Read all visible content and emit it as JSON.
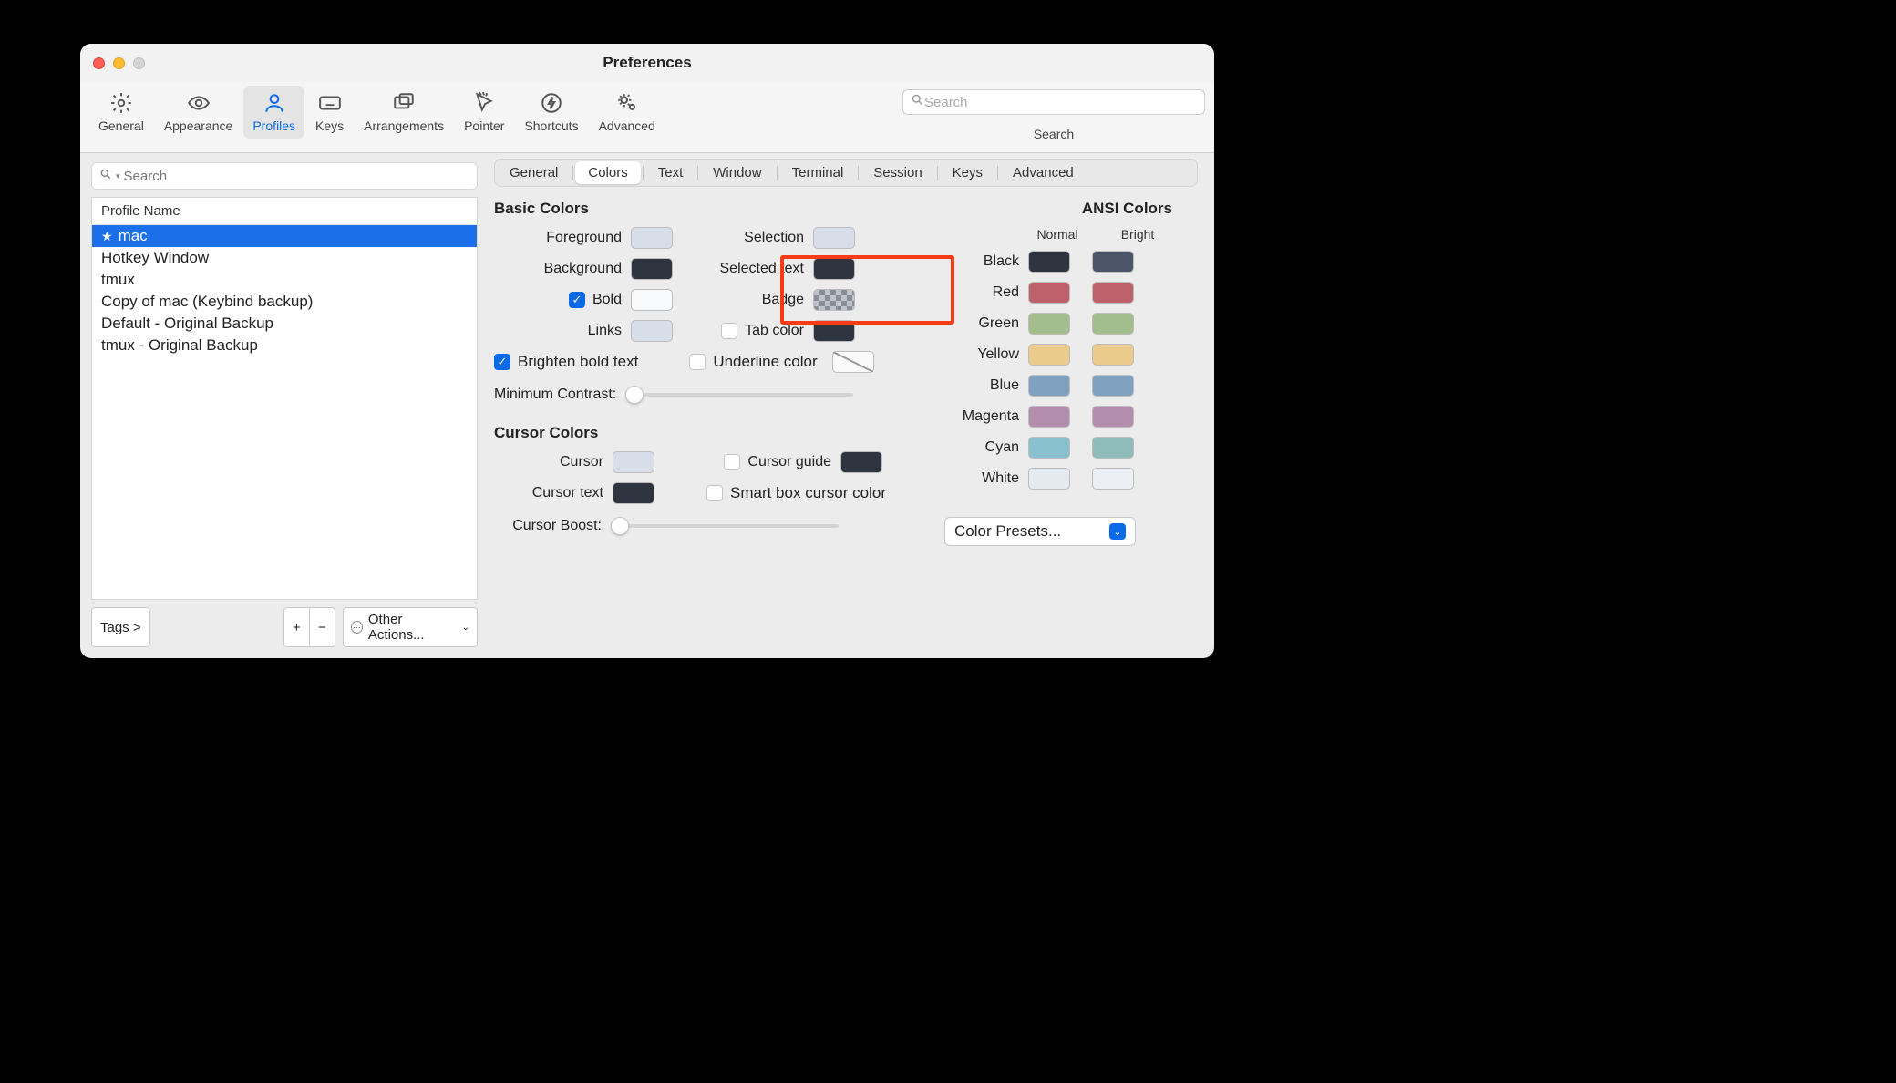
{
  "window": {
    "title": "Preferences"
  },
  "toolbar": {
    "items": [
      {
        "label": "General"
      },
      {
        "label": "Appearance"
      },
      {
        "label": "Profiles"
      },
      {
        "label": "Keys"
      },
      {
        "label": "Arrangements"
      },
      {
        "label": "Pointer"
      },
      {
        "label": "Shortcuts"
      },
      {
        "label": "Advanced"
      }
    ],
    "search_placeholder": "Search",
    "search_label": "Search"
  },
  "sidebar": {
    "search_placeholder": "Search",
    "header": "Profile Name",
    "profiles": [
      {
        "name": "mac",
        "starred": true,
        "selected": true
      },
      {
        "name": "Hotkey Window"
      },
      {
        "name": "tmux"
      },
      {
        "name": "Copy of mac (Keybind backup)"
      },
      {
        "name": "Default - Original Backup"
      },
      {
        "name": "tmux - Original Backup"
      }
    ],
    "tags_label": "Tags >",
    "other_actions_label": "Other Actions..."
  },
  "subtabs": [
    "General",
    "Colors",
    "Text",
    "Window",
    "Terminal",
    "Session",
    "Keys",
    "Advanced"
  ],
  "subtab_active": "Colors",
  "basic": {
    "title": "Basic Colors",
    "foreground": {
      "label": "Foreground",
      "color": "#d7dde9"
    },
    "background": {
      "label": "Background",
      "color": "#2e3440"
    },
    "bold": {
      "label": "Bold",
      "color": "#f7f9fb",
      "checked": true
    },
    "links": {
      "label": "Links",
      "color": "#d7dde9"
    },
    "selection": {
      "label": "Selection",
      "color": "#d7dde9"
    },
    "selected_text": {
      "label": "Selected text",
      "color": "#2e3440"
    },
    "badge": {
      "label": "Badge"
    },
    "tab_color": {
      "label": "Tab color",
      "color": "#2e3440",
      "checked": false
    },
    "brighten_bold": {
      "label": "Brighten bold text",
      "checked": true
    },
    "underline_color": {
      "label": "Underline color",
      "checked": false
    },
    "min_contrast_label": "Minimum Contrast:"
  },
  "cursor": {
    "title": "Cursor Colors",
    "cursor": {
      "label": "Cursor",
      "color": "#d7dde9"
    },
    "cursor_text": {
      "label": "Cursor text",
      "color": "#2e3440"
    },
    "cursor_guide": {
      "label": "Cursor guide",
      "color": "#2e3440",
      "checked": false
    },
    "smart_box": {
      "label": "Smart box cursor color",
      "checked": false
    },
    "boost_label": "Cursor Boost:"
  },
  "ansi": {
    "title": "ANSI Colors",
    "cols": {
      "normal": "Normal",
      "bright": "Bright"
    },
    "rows": [
      {
        "name": "Black",
        "normal": "#2e3440",
        "bright": "#4c566a"
      },
      {
        "name": "Red",
        "normal": "#bf616a",
        "bright": "#bf616a"
      },
      {
        "name": "Green",
        "normal": "#a3be8c",
        "bright": "#a3be8c"
      },
      {
        "name": "Yellow",
        "normal": "#ebcb8b",
        "bright": "#ebcb8b"
      },
      {
        "name": "Blue",
        "normal": "#81a1c1",
        "bright": "#81a1c1"
      },
      {
        "name": "Magenta",
        "normal": "#b48ead",
        "bright": "#b48ead"
      },
      {
        "name": "Cyan",
        "normal": "#88c0d0",
        "bright": "#8fbcbb"
      },
      {
        "name": "White",
        "normal": "#e5e9f0",
        "bright": "#eceff4"
      }
    ],
    "presets_label": "Color Presets..."
  }
}
